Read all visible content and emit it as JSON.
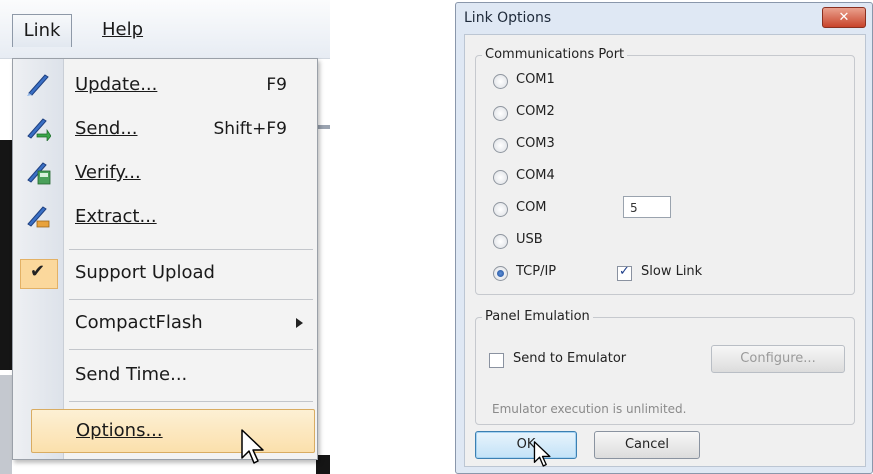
{
  "menubar": {
    "link": "Link",
    "help": "Help"
  },
  "menu": {
    "items": [
      {
        "label": "Update...",
        "shortcut": "F9",
        "icon": "update-icon"
      },
      {
        "label": "Send...",
        "shortcut": "Shift+F9",
        "icon": "send-icon"
      },
      {
        "label": "Verify...",
        "shortcut": "",
        "icon": "verify-icon"
      },
      {
        "label": "Extract...",
        "shortcut": "",
        "icon": "extract-icon"
      },
      {
        "label": "Support Upload",
        "checked": true
      },
      {
        "label": "CompactFlash",
        "submenu": true
      },
      {
        "label": "Send Time..."
      },
      {
        "label": "Options...",
        "highlighted": true
      }
    ]
  },
  "dialog": {
    "title": "Link Options",
    "close": "✕",
    "port_group": {
      "legend": "Communications Port",
      "options": [
        "COM1",
        "COM2",
        "COM3",
        "COM4",
        "COM",
        "USB",
        "TCP/IP"
      ],
      "selected": "TCP/IP",
      "com_number": "5",
      "slow_link_label": "Slow Link",
      "slow_link_checked": true
    },
    "emulation_group": {
      "legend": "Panel Emulation",
      "send_to_emulator_label": "Send to Emulator",
      "send_to_emulator_checked": false,
      "configure_label": "Configure...",
      "note": "Emulator execution is unlimited."
    },
    "ok_label": "OK",
    "cancel_label": "Cancel"
  },
  "colors": {
    "highlight": "#fbe0ac",
    "dialog_frame": "#dfe8f4",
    "close_button": "#c8442b"
  }
}
